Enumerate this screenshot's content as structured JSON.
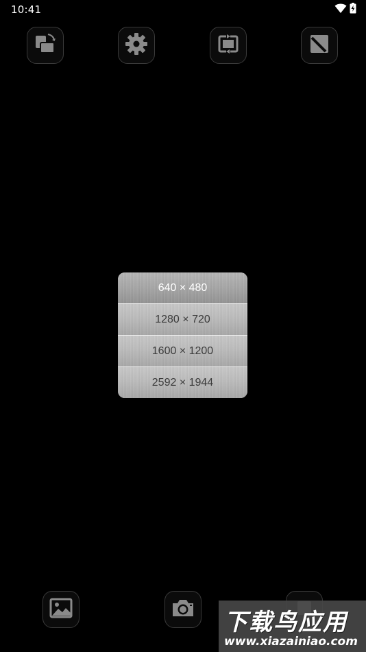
{
  "status_bar": {
    "time": "10:41",
    "icons": [
      "wifi-icon",
      "battery-charging-icon"
    ]
  },
  "toolbar_top": [
    {
      "icon": "rotate-orientation-icon"
    },
    {
      "icon": "gear-icon"
    },
    {
      "icon": "camera-switch-icon"
    },
    {
      "icon": "resize-diagonal-icon"
    }
  ],
  "resolution_menu": {
    "selected_index": 0,
    "options": [
      "640 × 480",
      "1280 × 720",
      "1600 × 1200",
      "2592 × 1944"
    ]
  },
  "toolbar_bottom": [
    {
      "icon": "gallery-icon"
    },
    {
      "icon": "camera-shutter-icon"
    },
    {
      "icon": "unknown-button-icon"
    }
  ],
  "watermark": {
    "title": "下载鸟应用",
    "url": "www.xiazainiao.com"
  },
  "colors": {
    "background": "#000000",
    "button_border": "#3a3a3a",
    "icon_gray": "#8a8a8a",
    "menu_text": "#3b3b3b",
    "menu_selected_text": "#ffffff"
  }
}
